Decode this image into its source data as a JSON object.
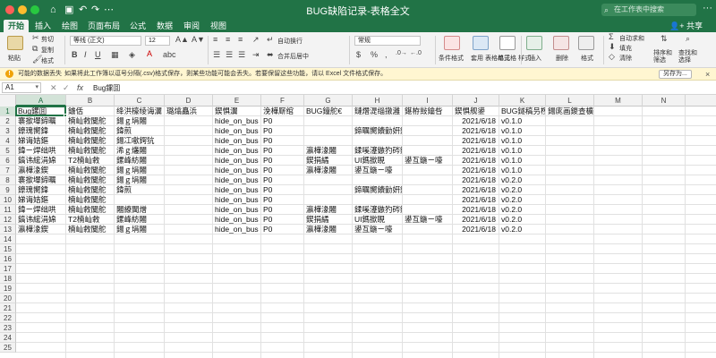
{
  "titlebar": {
    "title": "BUG缺陷记录-表格全文",
    "search_placeholder": "在工作表中搜索",
    "more": "···"
  },
  "tabs": [
    {
      "label": "开始"
    },
    {
      "label": "插入"
    },
    {
      "label": "绘图"
    },
    {
      "label": "页面布局"
    },
    {
      "label": "公式"
    },
    {
      "label": "数据"
    },
    {
      "label": "审阅"
    },
    {
      "label": "视图"
    }
  ],
  "share_label": "共享",
  "ribbon": {
    "paste": "粘贴",
    "cut": "剪切",
    "copy": "复制",
    "format_painter": "格式",
    "font_name": "等线 (正文)",
    "font_size": "12",
    "wrap_text": "自动换行",
    "merge_center": "合并后居中",
    "number_format": "常规",
    "conditional_format": "条件格式",
    "table_format": "套用\n表格格式",
    "cell_style": "单元格\n样式",
    "insert": "插入",
    "delete": "删除",
    "format": "格式",
    "autosum": "自动求和",
    "fill": "填充",
    "clear": "清除",
    "sort_filter": "排序和\n筛选",
    "find_select": "查找和\n选择"
  },
  "notice": {
    "label": "可能的数据丢失",
    "message": "如果将此工作簿以逗号分隔(.csv)格式保存，则某些功能可能会丢失。若要保留这些功能，请以 Excel 文件格式保存。",
    "button": "另存为...",
    "close": "×"
  },
  "formula_bar": {
    "name_box": "A1",
    "content": "Bug鏍囬"
  },
  "columns": [
    "A",
    "B",
    "C",
    "D",
    "E",
    "F",
    "G",
    "H",
    "I",
    "J",
    "K",
    "L",
    "M",
    "N"
  ],
  "rows": [
    "1",
    "2",
    "3",
    "4",
    "5",
    "6",
    "7",
    "8",
    "9",
    "10",
    "11",
    "12",
    "13",
    "14",
    "15",
    "16",
    "17",
    "18",
    "19",
    "20",
    "21",
    "22",
    "23",
    "24",
    "25"
  ],
  "cells": {
    "r1": [
      "Bug鏍囬",
      "鐪佸",
      "绛洪檺绫诲瀷",
      "璐熻矗浜",
      "鍥惧瀷",
      "浼樺厛绾",
      "BUG鐘舵€",
      "鏈熸湜缁撴灉",
      "鍖栫敱鑰呰",
      "鍥惧舰鍙",
      "BUG鐩稿叧椤电",
      "鍚庣画鍐查櫎"
    ],
    "r2": [
      "褰撳墠鍗曞",
      "楠屾敹闃舵",
      "鍚ｇ埍闂",
      "",
      "hide_on_bus",
      "P0",
      "",
      "",
      "",
      "2021/6/18",
      "v0.1.0",
      ""
    ],
    "r3": [
      "鐐瑰嚮鍏",
      "楠屾敹闃舵",
      "鍏煎",
      "",
      "hide_on_bus",
      "P0",
      "",
      "鍗曞嚮鐨勭姸鎬佷笉姝ｇ‘",
      "",
      "2021/6/18",
      "v0.1.0",
      ""
    ],
    "r4": [
      "娣诲姞鏂",
      "楠屾敹闃舵",
      "鍚冮噷鍔犺",
      "",
      "hide_on_bus",
      "P0",
      "",
      "",
      "",
      "2021/6/18",
      "v0.1.0",
      ""
    ],
    "r5": [
      "鍏ㄧ焊绌哄",
      "楠屾敹闃舵",
      "浠ｇ爜闂",
      "",
      "hide_on_bus",
      "P0",
      "瀛樺湪闂",
      "鍒嗘瀽鏃犳硶鍛ㄧ敤",
      "",
      "2021/6/18",
      "v0.1.0",
      ""
    ],
    "r6": [
      "鎬讳綋涓婂",
      "T2楠屾敹",
      "鏍峰紡闂",
      "",
      "hide_on_bus",
      "P0",
      "鍥捐繘",
      "UI鎷撳睍",
      "鍙互鍦ㄧ嚎",
      "2021/6/18",
      "v0.1.0",
      ""
    ],
    "r7": [
      "瀛樺湪鍥",
      "楠屾敹闃舵",
      "鍚ｇ埍闂",
      "",
      "hide_on_bus",
      "P0",
      "瀛樺湪闂",
      "鍙互鍦ㄧ嚎",
      "",
      "2021/6/18",
      "v0.1.0",
      ""
    ],
    "r8": [
      "褰撳墠鍗曞",
      "楠屾敹闃舵",
      "鍚ｇ埍闂",
      "",
      "hide_on_bus",
      "P0",
      "",
      "",
      "",
      "2021/6/18",
      "v0.2.0",
      ""
    ],
    "r9": [
      "鐐瑰嚮鍏",
      "楠屾敹闃舵",
      "鍏煎",
      "",
      "hide_on_bus",
      "P0",
      "",
      "鍗曞嚮鐨勭姸鎬佷笉姝ｇ‘",
      "",
      "2021/6/18",
      "v0.2.0",
      ""
    ],
    "r10": [
      "娣诲姞鏂",
      "楠屾敹闃舵",
      "",
      "",
      "hide_on_bus",
      "P0",
      "",
      "",
      "",
      "2021/6/18",
      "v0.2.0",
      ""
    ],
    "r11": [
      "鍏ㄧ焊绌哄",
      "楠屾敹闃舵",
      "闂繚閫熷",
      "",
      "hide_on_bus",
      "P0",
      "瀛樺湪闂",
      "鍒嗘瀽鏃犳硶鍛ㄧ敤",
      "",
      "2021/6/18",
      "v0.2.0",
      ""
    ],
    "r12": [
      "鎬讳綋涓婂",
      "T2楠屾敹",
      "鏍峰紡闂",
      "",
      "hide_on_bus",
      "P0",
      "鍥捐繘",
      "UI鎷撳睍",
      "鍙互鍦ㄧ嚎",
      "2021/6/18",
      "v0.2.0",
      ""
    ],
    "r13": [
      "瀛樺湪鍥",
      "楠屾敹闃舵",
      "鍚ｇ埍闂",
      "",
      "hide_on_bus",
      "P0",
      "瀛樺湪闂",
      "鍙互鍦ㄧ嚎",
      "",
      "2021/6/18",
      "v0.2.0",
      ""
    ]
  },
  "colors": {
    "accent": "#217346",
    "notice_bg": "#fff6d1",
    "warn": "#f0a30a"
  }
}
